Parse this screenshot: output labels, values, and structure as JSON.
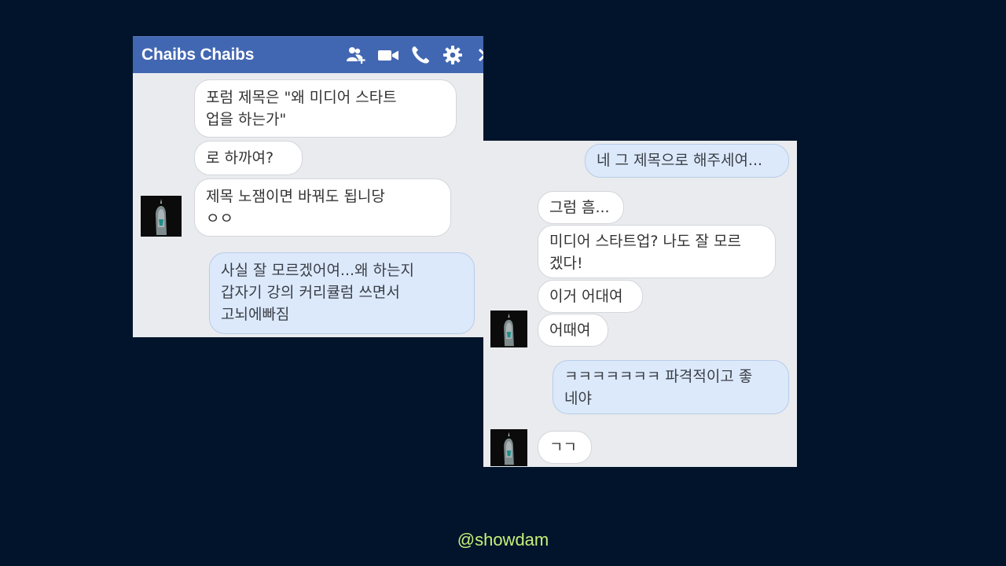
{
  "left_chat": {
    "title": "Chaibs Chaibs",
    "header_icons": [
      "add-friend-icon",
      "video-call-icon",
      "phone-icon",
      "settings-gear-icon",
      "close-icon"
    ],
    "messages": [
      {
        "direction": "incoming",
        "text": "포럼 제목은 \"왜 미디어 스타트\n업을 하는가\""
      },
      {
        "direction": "incoming",
        "text": "로 하까여?"
      },
      {
        "direction": "incoming",
        "text": "제목 노잼이면 바꿔도 됩니당\nㅇㅇ"
      },
      {
        "direction": "outgoing",
        "text": "사실 잘 모르겠어여...왜 하는지\n갑자기 강의 커리큘럼 쓰면서\n고뇌에빠짐"
      }
    ]
  },
  "right_chat": {
    "messages": [
      {
        "direction": "outgoing",
        "text": "네 그 제목으로 해주세여..."
      },
      {
        "direction": "incoming",
        "text": "그럼 흠..."
      },
      {
        "direction": "incoming",
        "text": "미디어 스타트업? 나도 잘 모르\n겠다!"
      },
      {
        "direction": "incoming",
        "text": "이거 어대여"
      },
      {
        "direction": "incoming",
        "text": "어때여"
      },
      {
        "direction": "outgoing",
        "text": "ㅋㅋㅋㅋㅋㅋㅋ 파격적이고 좋\n네야"
      },
      {
        "direction": "incoming",
        "text": "ㄱㄱ"
      }
    ]
  },
  "watermark": "@showdam",
  "colors": {
    "background": "#02142b",
    "header": "#4267b2",
    "incoming_bubble": "#ffffff",
    "outgoing_bubble": "#dce9fb",
    "watermark": "#c8f07a"
  }
}
